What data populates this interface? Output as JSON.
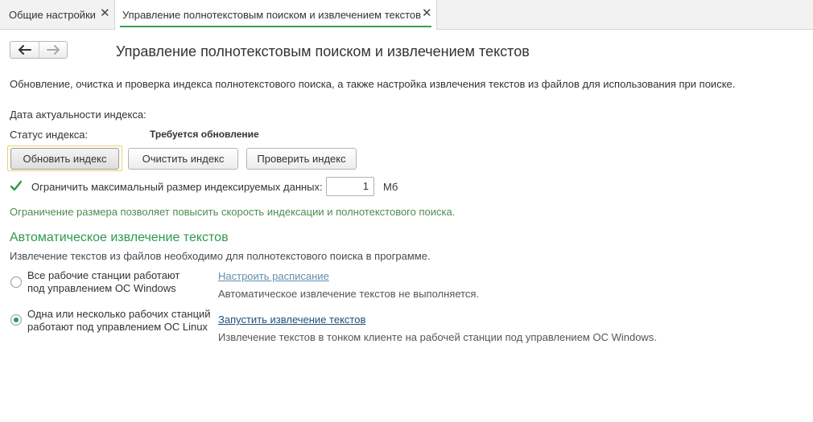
{
  "tabs": [
    {
      "label": "Общие настройки",
      "close": "✕"
    },
    {
      "label": "Управление полнотекстовым поиском и извлечением текстов",
      "close": "✕"
    }
  ],
  "page": {
    "title": "Управление полнотекстовым поиском и извлечением текстов",
    "description": "Обновление, очистка и проверка индекса полнотекстового поиска, а также настройка извлечения текстов из файлов для использования при поиске."
  },
  "index": {
    "date_label": "Дата актуальности индекса:",
    "status_label": "Статус индекса:",
    "status_value": "Требуется обновление",
    "update_button": "Обновить индекс",
    "clear_button": "Очистить индекс",
    "check_button": "Проверить индекс"
  },
  "limit": {
    "checked": true,
    "label": "Ограничить максимальный размер индексируемых данных:",
    "value": "1",
    "unit": "Мб",
    "note": "Ограничение размера позволяет повысить скорость индексации и полнотекстового поиска."
  },
  "extraction": {
    "title": "Автоматическое извлечение текстов",
    "description": "Извлечение текстов из файлов необходимо для полнотекстового поиска в программе.",
    "options": [
      {
        "label_line1": "Все рабочие станции работают",
        "label_line2": "под управлением ОС Windows",
        "selected": false,
        "link": "Настроить расписание",
        "hint": "Автоматическое извлечение текстов не выполняется."
      },
      {
        "label_line1": "Одна или несколько рабочих станций",
        "label_line2": "работают под управлением ОС Linux",
        "selected": true,
        "link": "Запустить извлечение текстов",
        "hint": "Извлечение текстов в тонком клиенте на рабочей станции под управлением ОС Windows."
      }
    ]
  },
  "colors": {
    "accent_green": "#2d9a4c",
    "note_green": "#4f8a4f",
    "link_blue": "#1f4f7a"
  }
}
